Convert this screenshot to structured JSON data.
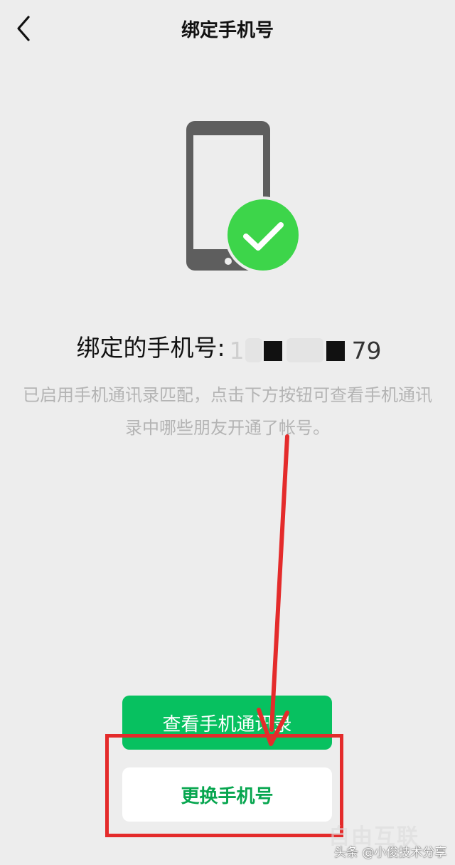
{
  "header": {
    "title": "绑定手机号"
  },
  "status": {
    "bound_label": "绑定的手机号:",
    "phone_first_digit": "1",
    "phone_last_digits": "79",
    "description": "已启用手机通讯录匹配，点击下方按钮可查看手机通讯录中哪些朋友开通了帐号。"
  },
  "actions": {
    "view_contacts_label": "查看手机通讯录",
    "change_phone_label": "更换手机号"
  },
  "watermark": {
    "text": "头条 @小俊技术分享",
    "brand": "自由互联"
  },
  "colors": {
    "accent_green": "#07c160",
    "check_green": "#3dd54a",
    "annotation_red": "#e42b2b",
    "background": "#ededed"
  },
  "icons": {
    "back": "chevron-left-icon",
    "phone": "phone-verified-icon"
  }
}
